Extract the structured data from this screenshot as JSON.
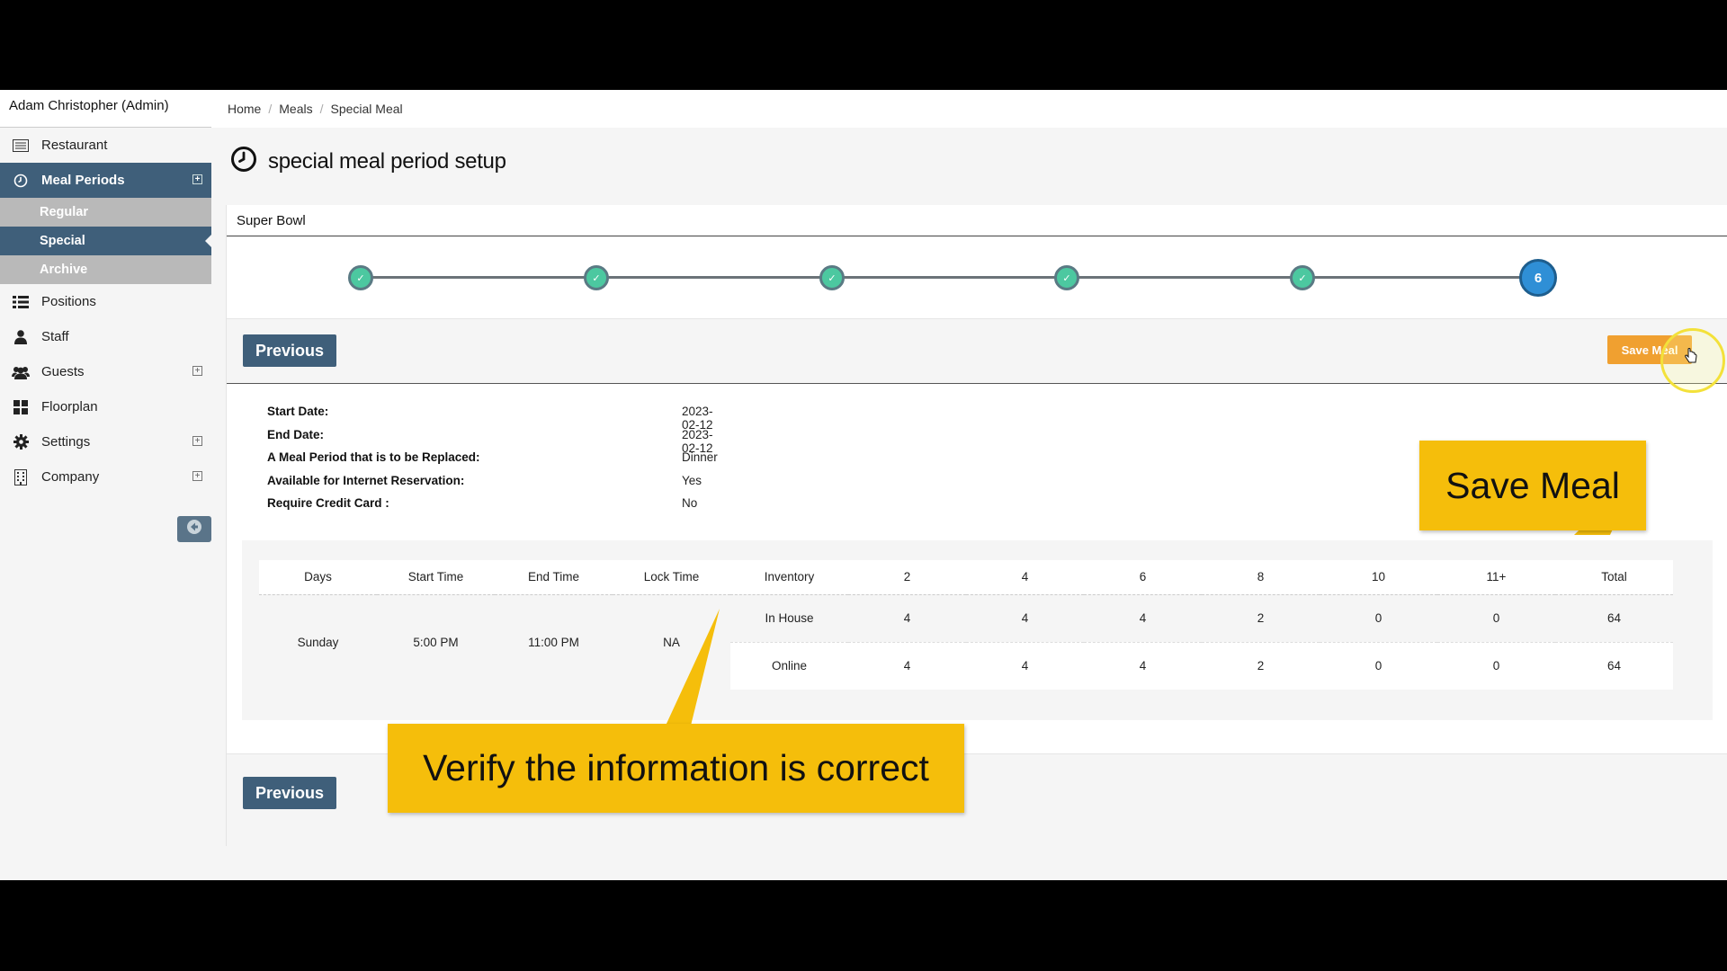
{
  "user": {
    "name": "Adam Christopher (Admin)"
  },
  "sidebar": {
    "items": [
      {
        "label": "Restaurant",
        "icon": "list-icon"
      },
      {
        "label": "Meal Periods",
        "icon": "clock-icon",
        "active": true
      },
      {
        "label": "Positions",
        "icon": "list-icon"
      },
      {
        "label": "Staff",
        "icon": "user-icon"
      },
      {
        "label": "Guests",
        "icon": "users-icon"
      },
      {
        "label": "Floorplan",
        "icon": "grid-icon"
      },
      {
        "label": "Settings",
        "icon": "gear-icon"
      },
      {
        "label": "Company",
        "icon": "building-icon"
      }
    ],
    "subitems": [
      {
        "label": "Regular"
      },
      {
        "label": "Special",
        "active": true
      },
      {
        "label": "Archive"
      }
    ]
  },
  "breadcrumb": {
    "home": "Home",
    "meals": "Meals",
    "current": "Special Meal"
  },
  "page": {
    "title": "special meal period setup"
  },
  "panel": {
    "title": "Super Bowl"
  },
  "stepper": {
    "current_step": "6",
    "total_steps": 6,
    "completed_steps": 5
  },
  "actions": {
    "previous": "Previous",
    "save": "Save Meal"
  },
  "summary": {
    "start_date_label": "Start Date:",
    "start_date": "2023-02-12",
    "end_date_label": "End Date:",
    "end_date": "2023-02-12",
    "replace_label": "A Meal Period that is to be Replaced:",
    "replace": "Dinner",
    "internet_label": "Available for Internet Reservation:",
    "internet": "Yes",
    "credit_label": "Require Credit Card :",
    "credit": "No"
  },
  "schedule": {
    "headers": [
      "Days",
      "Start Time",
      "End Time",
      "Lock Time",
      "Inventory",
      "2",
      "4",
      "6",
      "8",
      "10",
      "11+",
      "Total"
    ],
    "day": "Sunday",
    "start": "5:00 PM",
    "end": "11:00 PM",
    "lock": "NA",
    "rows": [
      {
        "inventory": "In House",
        "values": [
          "4",
          "4",
          "4",
          "2",
          "0",
          "0",
          "64"
        ]
      },
      {
        "inventory": "Online",
        "values": [
          "4",
          "4",
          "4",
          "2",
          "0",
          "0",
          "64"
        ]
      }
    ]
  },
  "callouts": {
    "save": "Save Meal",
    "verify": "Verify the information is correct"
  },
  "colors": {
    "accent": "#3f5f7a",
    "save": "#f0a030",
    "callout": "#f5be0b",
    "step_done": "#4cc8a0",
    "step_current": "#2f8fd6"
  }
}
